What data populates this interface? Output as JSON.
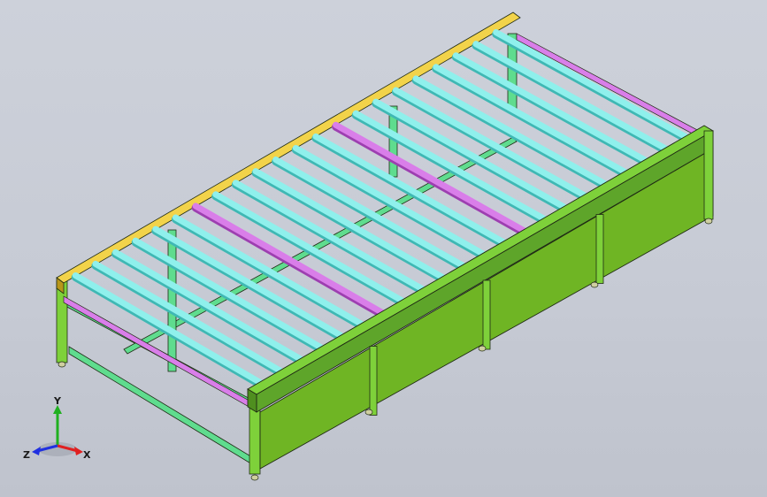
{
  "model": {
    "roller_count": 22,
    "colors": {
      "background": "#c9cdd6",
      "frame_green": "#7ed13a",
      "frame_green_dark": "#4f8f1f",
      "panel_green": "#6fb524",
      "leg_teal": "#5fdc8e",
      "leg_teal_dark": "#2f9a5a",
      "roller_cyan": "#8ff0ec",
      "roller_cyan_dark": "#3fb8b4",
      "side_rail_yellow": "#f2d34a",
      "side_rail_yellow_dark": "#b8961a",
      "accent_magenta": "#d97ee9",
      "accent_magenta_dark": "#9d3fb0",
      "outline": "#1f2a14",
      "foot": "#cfcfa0"
    }
  },
  "triad": {
    "x_label": "X",
    "y_label": "Y",
    "z_label": "Z",
    "colors": {
      "x": "#e02020",
      "y": "#20b020",
      "z": "#2030e0"
    }
  }
}
